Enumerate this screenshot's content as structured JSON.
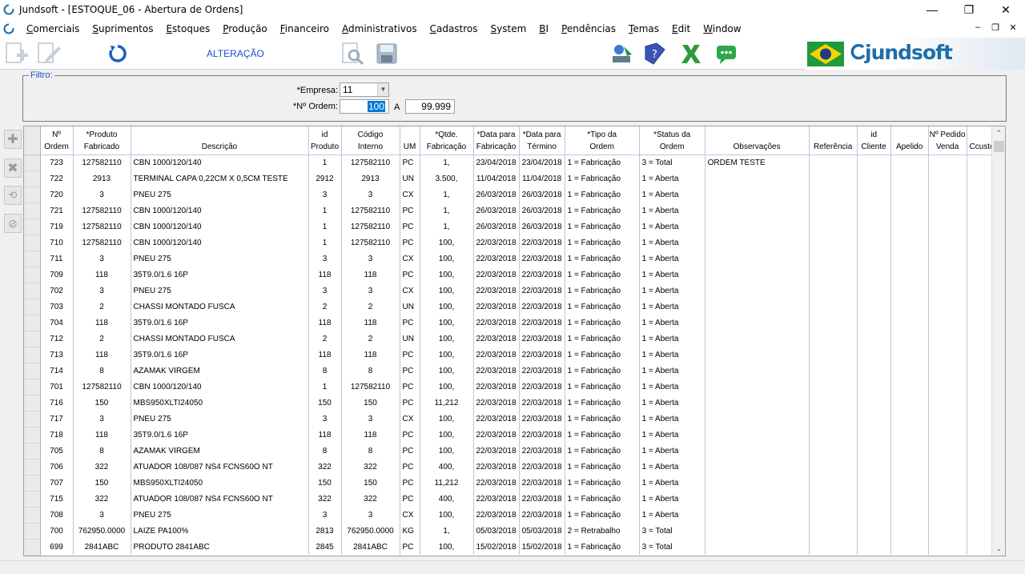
{
  "window": {
    "title": "Jundsoft - [ESTOQUE_06 - Abertura de Ordens]"
  },
  "menu": [
    "Comerciais",
    "Suprimentos",
    "Estoques",
    "Produção",
    "Financeiro",
    "Administrativos",
    "Cadastros",
    "System",
    "BI",
    "Pendências",
    "Temas",
    "Edit",
    "Window"
  ],
  "toolbar": {
    "mode_label": "ALTERAÇÃO"
  },
  "brand": {
    "logo": "jundsoft"
  },
  "filter": {
    "legend": "Filtro:",
    "empresa_label": "*Empresa:",
    "empresa_value": "11",
    "ordem_label": "*Nº Ordem:",
    "ordem_from": "100",
    "ordem_to_label": "A",
    "ordem_to": "99.999"
  },
  "columns": [
    "Nº\nOrdem",
    "*Produto\nFabricado",
    "Descrição",
    "id\nProduto",
    "Código\nInterno",
    "UM",
    "*Qtde.\nFabricação",
    "*Data para\nFabricação",
    "*Data para\nTérmino",
    "*Tipo da\nOrdem",
    "*Status da\nOrdem",
    "Observações",
    "Referência",
    "id\nCliente",
    "Apelido",
    "Nº Pedido\nVenda",
    "Ccusto"
  ],
  "rows": [
    [
      "723",
      "127582110",
      "CBN 1000/120/140",
      "1",
      "127582110",
      "PC",
      "1,",
      "23/04/2018",
      "23/04/2018",
      "1 = Fabricação",
      "3 = Total",
      "ORDEM TESTE"
    ],
    [
      "722",
      "2913",
      "TERMINAL CAPA 0,22CM X 0,5CM TESTE",
      "2912",
      "2913",
      "UN",
      "3.500,",
      "11/04/2018",
      "11/04/2018",
      "1 = Fabricação",
      "1 = Aberta",
      ""
    ],
    [
      "720",
      "3",
      "PNEU 275",
      "3",
      "3",
      "CX",
      "1,",
      "26/03/2018",
      "26/03/2018",
      "1 = Fabricação",
      "1 = Aberta",
      ""
    ],
    [
      "721",
      "127582110",
      "CBN 1000/120/140",
      "1",
      "127582110",
      "PC",
      "1,",
      "26/03/2018",
      "26/03/2018",
      "1 = Fabricação",
      "1 = Aberta",
      ""
    ],
    [
      "719",
      "127582110",
      "CBN 1000/120/140",
      "1",
      "127582110",
      "PC",
      "1,",
      "26/03/2018",
      "26/03/2018",
      "1 = Fabricação",
      "1 = Aberta",
      ""
    ],
    [
      "710",
      "127582110",
      "CBN 1000/120/140",
      "1",
      "127582110",
      "PC",
      "100,",
      "22/03/2018",
      "22/03/2018",
      "1 = Fabricação",
      "1 = Aberta",
      ""
    ],
    [
      "711",
      "3",
      "PNEU 275",
      "3",
      "3",
      "CX",
      "100,",
      "22/03/2018",
      "22/03/2018",
      "1 = Fabricação",
      "1 = Aberta",
      ""
    ],
    [
      "709",
      "118",
      "35T9.0/1.6 16P",
      "118",
      "118",
      "PC",
      "100,",
      "22/03/2018",
      "22/03/2018",
      "1 = Fabricação",
      "1 = Aberta",
      ""
    ],
    [
      "702",
      "3",
      "PNEU 275",
      "3",
      "3",
      "CX",
      "100,",
      "22/03/2018",
      "22/03/2018",
      "1 = Fabricação",
      "1 = Aberta",
      ""
    ],
    [
      "703",
      "2",
      "CHASSI MONTADO FUSCA",
      "2",
      "2",
      "UN",
      "100,",
      "22/03/2018",
      "22/03/2018",
      "1 = Fabricação",
      "1 = Aberta",
      ""
    ],
    [
      "704",
      "118",
      "35T9.0/1.6 16P",
      "118",
      "118",
      "PC",
      "100,",
      "22/03/2018",
      "22/03/2018",
      "1 = Fabricação",
      "1 = Aberta",
      ""
    ],
    [
      "712",
      "2",
      "CHASSI MONTADO FUSCA",
      "2",
      "2",
      "UN",
      "100,",
      "22/03/2018",
      "22/03/2018",
      "1 = Fabricação",
      "1 = Aberta",
      ""
    ],
    [
      "713",
      "118",
      "35T9.0/1.6 16P",
      "118",
      "118",
      "PC",
      "100,",
      "22/03/2018",
      "22/03/2018",
      "1 = Fabricação",
      "1 = Aberta",
      ""
    ],
    [
      "714",
      "8",
      "AZAMAK VIRGEM",
      "8",
      "8",
      "PC",
      "100,",
      "22/03/2018",
      "22/03/2018",
      "1 = Fabricação",
      "1 = Aberta",
      ""
    ],
    [
      "701",
      "127582110",
      "CBN 1000/120/140",
      "1",
      "127582110",
      "PC",
      "100,",
      "22/03/2018",
      "22/03/2018",
      "1 = Fabricação",
      "1 = Aberta",
      ""
    ],
    [
      "716",
      "150",
      "MBS950XLTI24050",
      "150",
      "150",
      "PC",
      "11,212",
      "22/03/2018",
      "22/03/2018",
      "1 = Fabricação",
      "1 = Aberta",
      ""
    ],
    [
      "717",
      "3",
      "PNEU 275",
      "3",
      "3",
      "CX",
      "100,",
      "22/03/2018",
      "22/03/2018",
      "1 = Fabricação",
      "1 = Aberta",
      ""
    ],
    [
      "718",
      "118",
      "35T9.0/1.6 16P",
      "118",
      "118",
      "PC",
      "100,",
      "22/03/2018",
      "22/03/2018",
      "1 = Fabricação",
      "1 = Aberta",
      ""
    ],
    [
      "705",
      "8",
      "AZAMAK VIRGEM",
      "8",
      "8",
      "PC",
      "100,",
      "22/03/2018",
      "22/03/2018",
      "1 = Fabricação",
      "1 = Aberta",
      ""
    ],
    [
      "706",
      "322",
      "ATUADOR 108/087 NS4 FCNS60O NT",
      "322",
      "322",
      "PC",
      "400,",
      "22/03/2018",
      "22/03/2018",
      "1 = Fabricação",
      "1 = Aberta",
      ""
    ],
    [
      "707",
      "150",
      "MBS950XLTI24050",
      "150",
      "150",
      "PC",
      "11,212",
      "22/03/2018",
      "22/03/2018",
      "1 = Fabricação",
      "1 = Aberta",
      ""
    ],
    [
      "715",
      "322",
      "ATUADOR 108/087 NS4 FCNS60O NT",
      "322",
      "322",
      "PC",
      "400,",
      "22/03/2018",
      "22/03/2018",
      "1 = Fabricação",
      "1 = Aberta",
      ""
    ],
    [
      "708",
      "3",
      "PNEU 275",
      "3",
      "3",
      "CX",
      "100,",
      "22/03/2018",
      "22/03/2018",
      "1 = Fabricação",
      "1 = Aberta",
      ""
    ],
    [
      "700",
      "762950.0000",
      "LAIZE PA100%",
      "2813",
      "762950.0000",
      "KG",
      "1,",
      "05/03/2018",
      "05/03/2018",
      "2 = Retrabalho",
      "3 = Total",
      ""
    ],
    [
      "699",
      "2841ABC",
      "PRODUTO 2841ABC",
      "2845",
      "2841ABC",
      "PC",
      "100,",
      "15/02/2018",
      "15/02/2018",
      "1 = Fabricação",
      "3 = Total",
      ""
    ]
  ]
}
